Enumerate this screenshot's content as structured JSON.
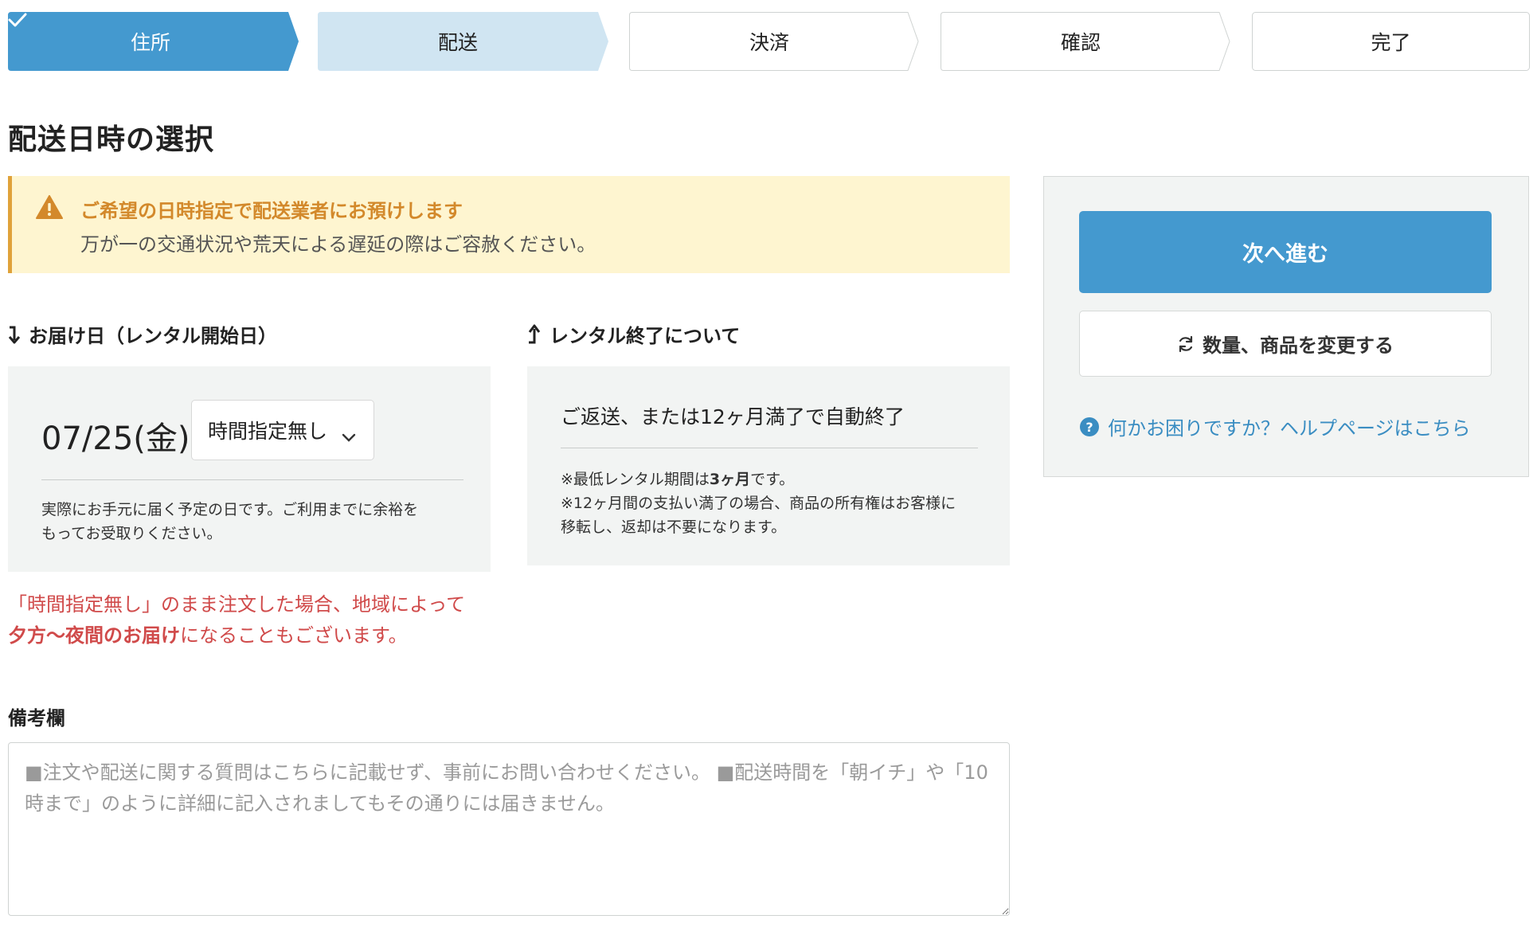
{
  "steps": [
    {
      "label": "住所",
      "state": "done"
    },
    {
      "label": "配送",
      "state": "current"
    },
    {
      "label": "決済",
      "state": "todo"
    },
    {
      "label": "確認",
      "state": "todo"
    },
    {
      "label": "完了",
      "state": "todo"
    }
  ],
  "page_title": "配送日時の選択",
  "notice": {
    "title": "ご希望の日時指定で配送業者にお預けします",
    "text": "万が一の交通状況や荒天による遅延の際はご容赦ください。"
  },
  "delivery": {
    "heading": "お届け日（レンタル開始日）",
    "date": "07/25(金)",
    "time_select": "時間指定無し",
    "note_line1": "実際にお手元に届く予定の日です。ご利用までに余裕を",
    "note_line2": "もってお受取りください。",
    "warning_line1": "「時間指定無し」のまま注文した場合、地域によって",
    "warning_bold": "夕方〜夜間のお届け",
    "warning_rest": "になることもございます。"
  },
  "rental_end": {
    "heading": "レンタル終了について",
    "main": "ご返送、または12ヶ月満了で自動終了",
    "note1_prefix": "※最低レンタル期間は",
    "note1_bold": "3ヶ月",
    "note1_suffix": "です。",
    "note2_line1": "※12ヶ月間の支払い満了の場合、商品の所有権はお客様に",
    "note2_line2": "移転し、返却は不要になります。"
  },
  "remarks": {
    "label": "備考欄",
    "placeholder": "■注文や配送に関する質問はこちらに記載せず、事前にお問い合わせください。 ■配送時間を「朝イチ」や「10時まで」のように詳細に記入されましてもその通りには届きません。"
  },
  "side": {
    "next_label": "次へ進む",
    "change_label": "数量、商品を変更する",
    "help_label": "何かお困りですか？ヘルプページはこちら"
  },
  "colors": {
    "step_done": "#4499cf",
    "step_current": "#d0e5f2",
    "notice_bg": "#fef5d0",
    "notice_accent": "#e0a23a",
    "warning_red": "#d04a4a",
    "link": "#3a8dc2"
  }
}
